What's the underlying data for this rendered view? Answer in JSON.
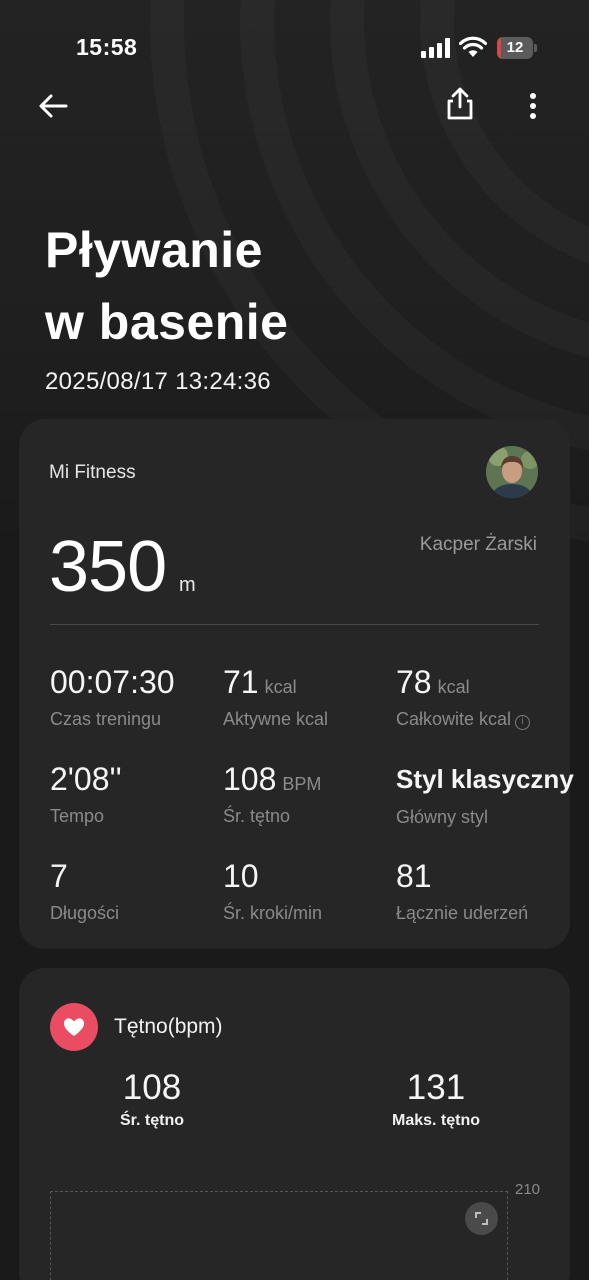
{
  "status_bar": {
    "time": "15:58",
    "battery_level": "12",
    "battery_fraction": 0.12
  },
  "header": {
    "title_line1": "Pływanie",
    "title_line2": "w basenie",
    "datetime": "2025/08/17 13:24:36"
  },
  "summary": {
    "source": "Mi Fitness",
    "user_name": "Kacper Żarski",
    "distance_value": "350",
    "distance_unit": "m",
    "stats": [
      {
        "value": "00:07:30",
        "unit": "",
        "label": "Czas treningu"
      },
      {
        "value": "71",
        "unit": "kcal",
        "label": "Aktywne kcal"
      },
      {
        "value": "78",
        "unit": "kcal",
        "label": "Całkowite kcal"
      },
      {
        "value": "2'08''",
        "unit": "",
        "label": "Tempo"
      },
      {
        "value": "108",
        "unit": "BPM",
        "label": "Śr. tętno"
      },
      {
        "value": "Styl klasyczny",
        "unit": "",
        "label": "Główny styl"
      },
      {
        "value": "7",
        "unit": "",
        "label": "Długości"
      },
      {
        "value": "10",
        "unit": "",
        "label": "Śr. kroki/min"
      },
      {
        "value": "81",
        "unit": "",
        "label": "Łącznie uderzeń"
      }
    ]
  },
  "heart_rate": {
    "title": "Tętno(bpm)",
    "avg_value": "108",
    "avg_label": "Śr. tętno",
    "max_value": "131",
    "max_label": "Maks. tętno",
    "chart_max_tick": "210"
  },
  "colors": {
    "background": "#1a1a1a",
    "card": "#262626",
    "heart_accent": "#ea4c64",
    "battery_low": "#d44747"
  }
}
